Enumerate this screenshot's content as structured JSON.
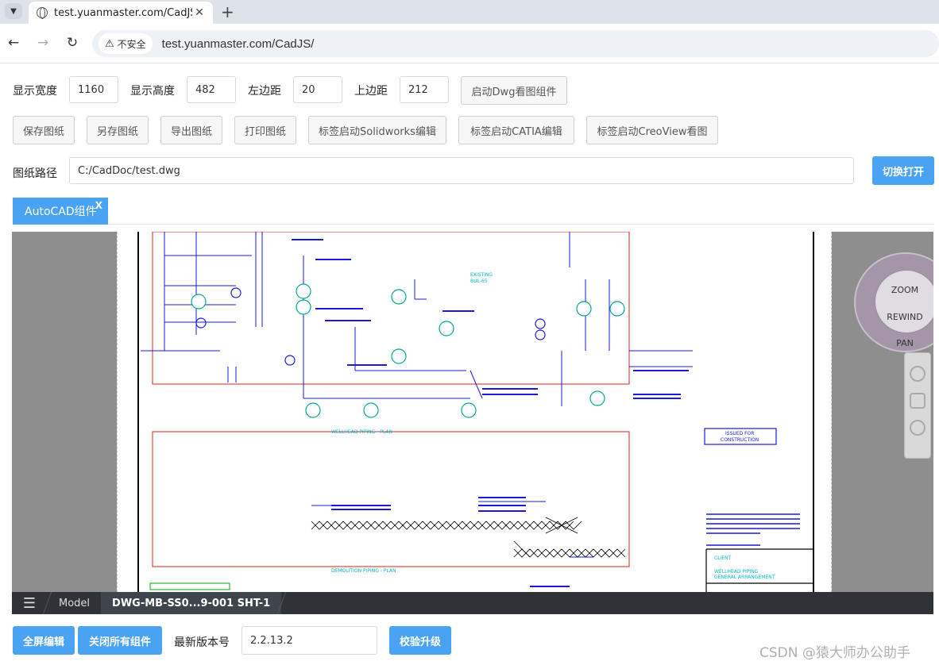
{
  "browser": {
    "tab_title": "test.yuanmaster.com/CadJS/",
    "url_security": "不安全",
    "url": "test.yuanmaster.com/CadJS/"
  },
  "settings": {
    "width_label": "显示宽度",
    "width_value": "1160",
    "height_label": "显示高度",
    "height_value": "482",
    "left_label": "左边距",
    "left_value": "20",
    "top_label": "上边距",
    "top_value": "212",
    "launch_button": "启动Dwg看图组件"
  },
  "actions": {
    "save": "保存图纸",
    "save_as": "另存图纸",
    "export": "导出图纸",
    "print": "打印图纸",
    "solidworks": "标签启动Solidworks编辑",
    "catia": "标签启动CATIA编辑",
    "creoview": "标签启动CreoView看图"
  },
  "path": {
    "label": "图纸路径",
    "value": "C:/CadDoc/test.dwg",
    "switch_button": "切换打开"
  },
  "component_tab": {
    "label": "AutoCAD组件",
    "close": "X"
  },
  "viewer": {
    "nav_zoom": "ZOOM",
    "nav_rewind": "REWIND",
    "nav_pan": "PAN",
    "tabs": [
      "Model",
      "DWG-MB-SS0...9-001 SHT-1"
    ],
    "drawing_texts": {
      "existing": "EXISTING",
      "existing_code": "BUL-65",
      "issued_1": "ISSUED FOR",
      "issued_2": "CONSTRUCTION",
      "plan_1": "WELLHEAD PIPING - PLAN",
      "plan_2": "DEMOLITION PIPING - PLAN",
      "client": "CLIENT",
      "client_1": "WELLHEAD PIPING",
      "client_2": "GENERAL ARRANGEMENT"
    }
  },
  "footer": {
    "fullscreen": "全屏编辑",
    "close_all": "关闭所有组件",
    "version_label": "最新版本号",
    "version_value": "2.2.13.2",
    "upgrade": "校验升级"
  },
  "watermark": "CSDN @猿大师办公助手"
}
